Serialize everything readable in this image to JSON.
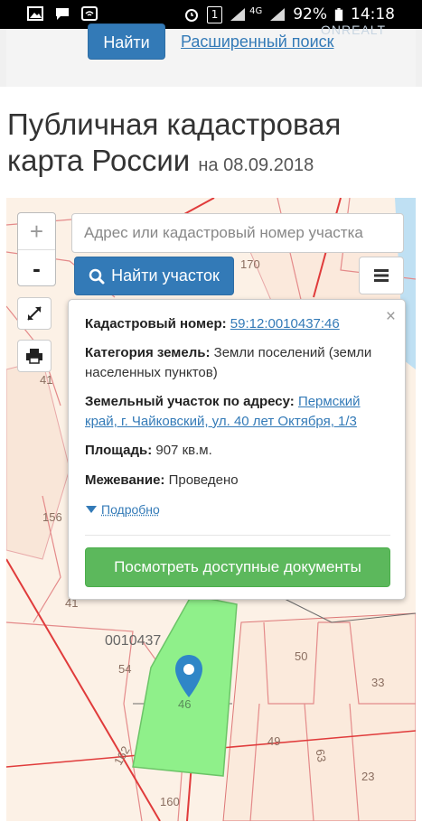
{
  "status_bar": {
    "battery": "92%",
    "time": "14:18",
    "network": "4G",
    "sim_badge": "1",
    "icons": [
      "gallery-icon",
      "message-icon",
      "wifi-icon",
      "alarm-icon",
      "sim-icon",
      "signal-icon",
      "battery-icon"
    ]
  },
  "top": {
    "find_button": "Найти",
    "advanced_link": "Расширенный поиск",
    "watermark": "ONREALT"
  },
  "page": {
    "title": "Публичная кадастровая карта России",
    "date_suffix": "на 08.09.2018"
  },
  "map": {
    "search_placeholder": "Адрес или кадастровый номер участка",
    "find_plot_button": "Найти участок",
    "zoom_in": "+",
    "zoom_out": "-",
    "plot_labels": [
      "170",
      "41",
      "156",
      "41",
      "0010437",
      "54",
      "46",
      "50",
      "33",
      "49",
      "63",
      "23",
      "162",
      "160"
    ],
    "highlight_color": "#8ff08a"
  },
  "popup": {
    "cadastral_label": "Кадастровый номер:",
    "cadastral_value": "59:12:0010437:46",
    "category_label": "Категория земель:",
    "category_value": "Земли поселений (земли населенных пунктов)",
    "address_label": "Земельный участок по адресу:",
    "address_value": "Пермский край, г. Чайковский, ул. 40 лет Октября, 1/3",
    "area_label": "Площадь:",
    "area_value": "907 кв.м.",
    "survey_label": "Межевание:",
    "survey_value": "Проведено",
    "more_link": "Подробно",
    "docs_button": "Посмотреть доступные документы",
    "close": "×"
  }
}
